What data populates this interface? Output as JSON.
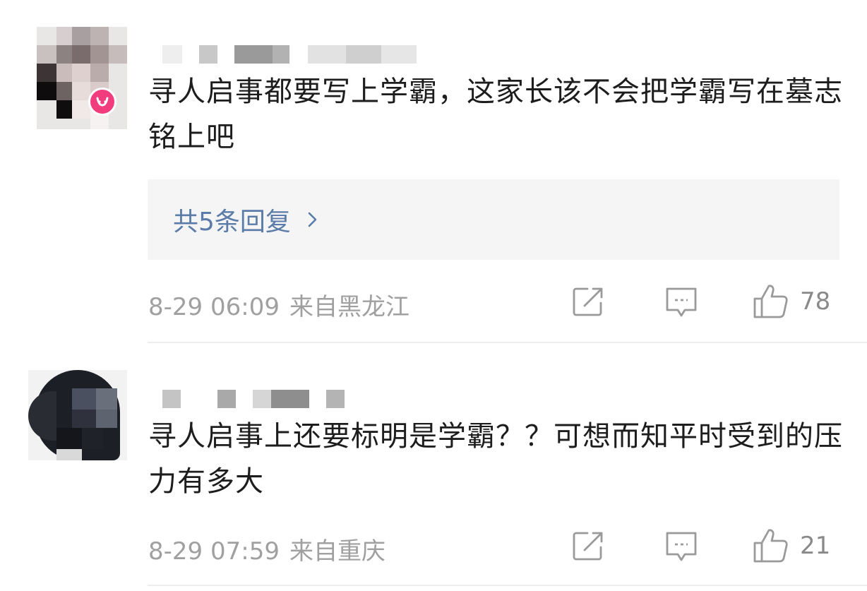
{
  "comments": [
    {
      "text": "寻人启事都要写上学霸，这家长该不会把学霸写在墓志铭上吧",
      "replies_label": "共5条回复",
      "time": "8-29 06:09",
      "location": "来自黑龙江",
      "likes": "78"
    },
    {
      "text": "寻人启事上还要标明是学霸？？可想而知平时受到的压力有多大",
      "time": "8-29 07:59",
      "location": "来自重庆",
      "likes": "21"
    }
  ],
  "icons": {
    "share": "share-icon",
    "comment": "comment-icon",
    "like": "thumbs-up-icon",
    "chevron": "chevron-right-icon",
    "badge": "vip-badge-icon"
  },
  "colors": {
    "text": "#1d1d1d",
    "meta": "#a0a0a0",
    "link": "#5b7ca8",
    "reply_bg": "#f5f5f5",
    "badge": "#f23d7c"
  }
}
